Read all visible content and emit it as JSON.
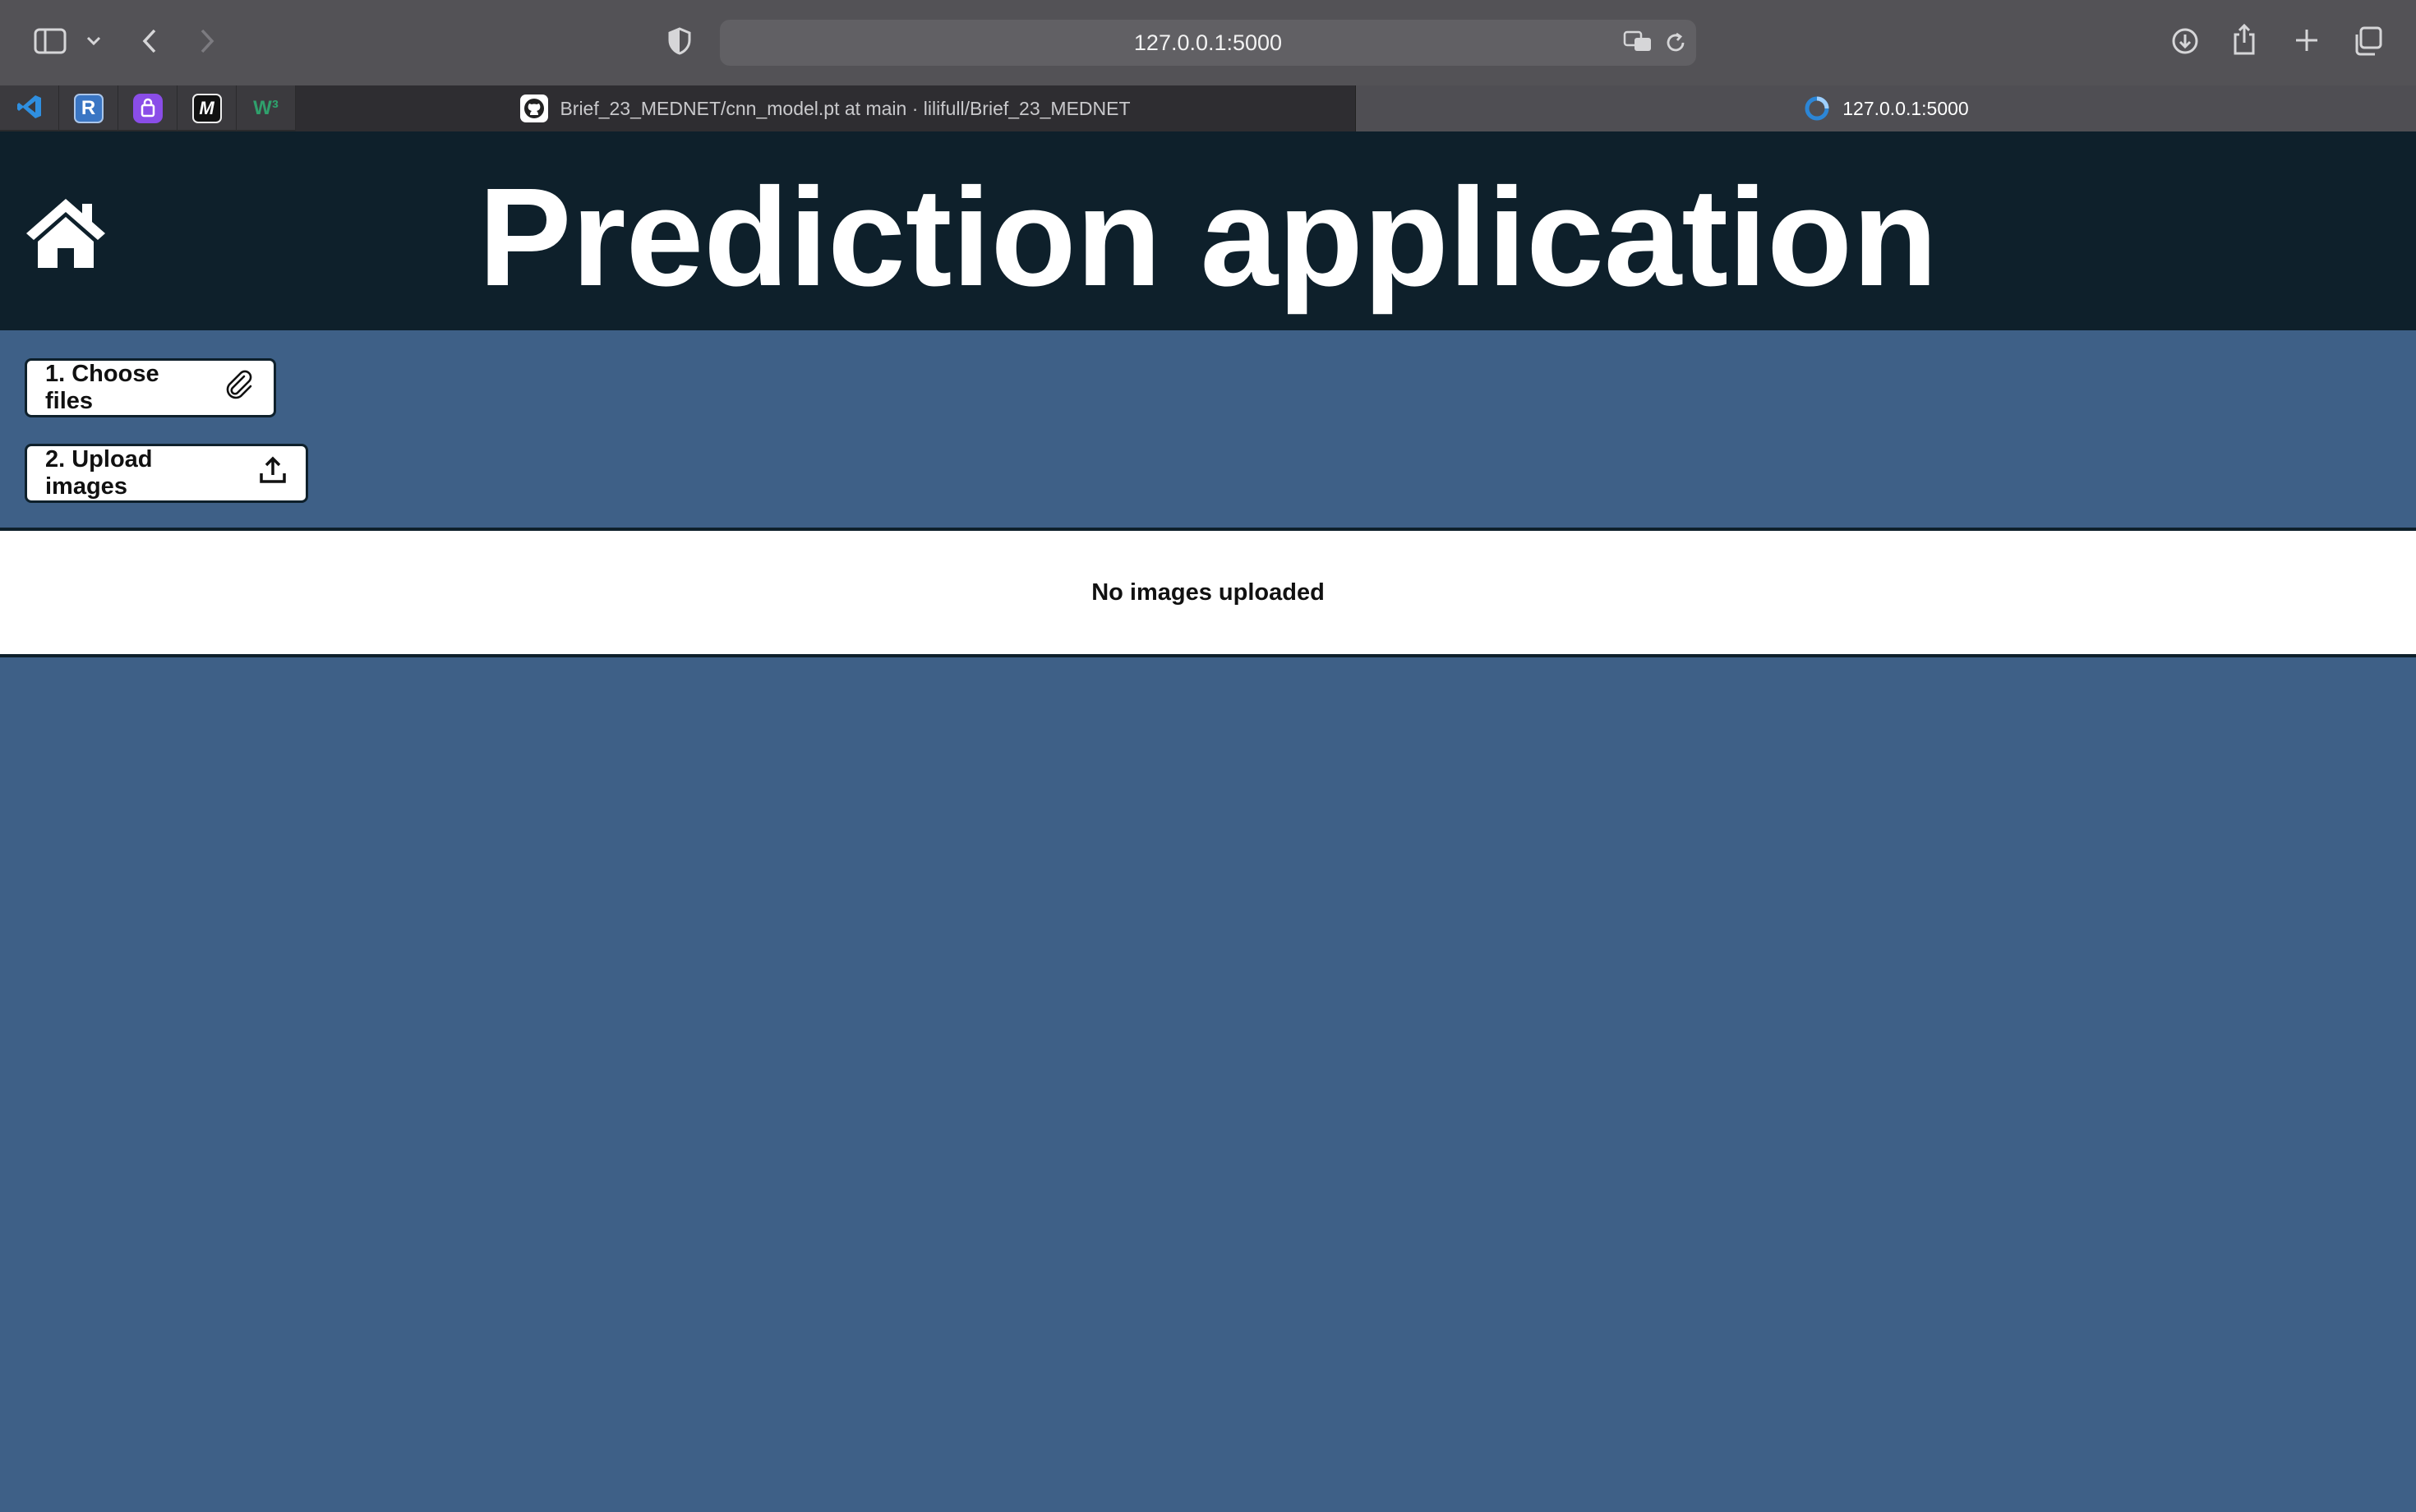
{
  "browser": {
    "url": "127.0.0.1:5000",
    "tabs": [
      {
        "title": "Brief_23_MEDNET/cnn_model.pt at main · lilifull/Brief_23_MEDNET",
        "active": false,
        "icon": "github-icon"
      },
      {
        "title": "127.0.0.1:5000",
        "active": true,
        "icon": "loading-icon"
      }
    ],
    "pinned_tabs": [
      {
        "icon": "vscode-icon",
        "label": ""
      },
      {
        "icon": "r-icon",
        "label": "R"
      },
      {
        "icon": "proton-icon",
        "label": ""
      },
      {
        "icon": "m-icon",
        "label": "M"
      },
      {
        "icon": "w3-icon",
        "label": "W³"
      }
    ]
  },
  "header": {
    "title": "Prediction application",
    "home_icon": "home-icon"
  },
  "actions": {
    "choose_label": "1. Choose files",
    "upload_label": "2. Upload images"
  },
  "status": {
    "message": "No images uploaded"
  },
  "colors": {
    "header_bg": "#0e202b",
    "page_bg": "#3e6087",
    "band_bg": "#ffffff"
  }
}
